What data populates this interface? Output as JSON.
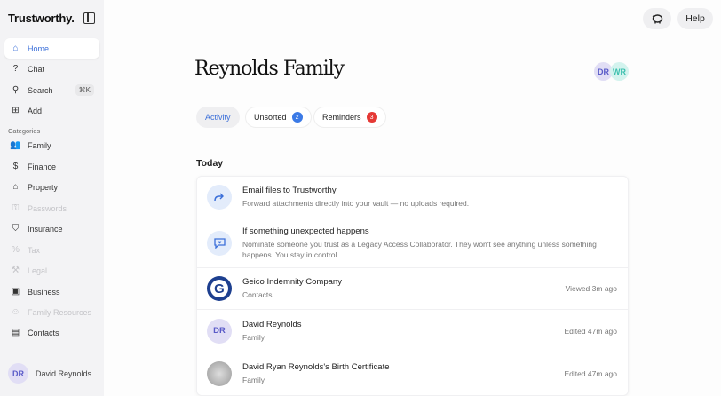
{
  "sidebar": {
    "brand": "Trustworthy.",
    "search_shortcut": "⌘K",
    "categories_label": "Categories",
    "items": [
      {
        "label": "Home",
        "icon": "home-icon",
        "glyph": "⌂",
        "state": "active"
      },
      {
        "label": "Chat",
        "icon": "chat-icon",
        "glyph": "?",
        "state": "normal"
      },
      {
        "label": "Search",
        "icon": "search-icon",
        "glyph": "⚲",
        "state": "normal"
      },
      {
        "label": "Add",
        "icon": "add-icon",
        "glyph": "⊞",
        "state": "normal"
      },
      {
        "label": "Family",
        "icon": "family-icon",
        "glyph": "👥",
        "state": "normal"
      },
      {
        "label": "Finance",
        "icon": "dollar-icon",
        "glyph": "$",
        "state": "normal"
      },
      {
        "label": "Property",
        "icon": "property-icon",
        "glyph": "⌂",
        "state": "normal"
      },
      {
        "label": "Passwords",
        "icon": "key-icon",
        "glyph": "⚿",
        "state": "disabled"
      },
      {
        "label": "Insurance",
        "icon": "shield-icon",
        "glyph": "⛉",
        "state": "normal"
      },
      {
        "label": "Tax",
        "icon": "percent-icon",
        "glyph": "%",
        "state": "disabled"
      },
      {
        "label": "Legal",
        "icon": "gavel-icon",
        "glyph": "⚒",
        "state": "disabled"
      },
      {
        "label": "Business",
        "icon": "briefcase-icon",
        "glyph": "▣",
        "state": "normal"
      },
      {
        "label": "Family Resources",
        "icon": "person-icon",
        "glyph": "☺",
        "state": "disabled"
      },
      {
        "label": "Contacts",
        "icon": "contacts-icon",
        "glyph": "▤",
        "state": "normal"
      }
    ],
    "user": {
      "initials": "DR",
      "name": "David Reynolds"
    }
  },
  "header": {
    "help_label": "Help",
    "piggy_icon": "piggy-bank-icon"
  },
  "main": {
    "title": "Reynolds Family",
    "members": [
      {
        "initials": "DR",
        "bg": "#e1def5",
        "fg": "#5a5bc8"
      },
      {
        "initials": "WR",
        "bg": "#d3f3ee",
        "fg": "#3cbfae"
      }
    ],
    "tabs": [
      {
        "label": "Activity",
        "active": true
      },
      {
        "label": "Unsorted",
        "count": "2",
        "badge_color": "#3b7ae6"
      },
      {
        "label": "Reminders",
        "count": "3",
        "badge_color": "#e53935"
      }
    ],
    "section": "Today",
    "rows": [
      {
        "title": "Email files to Trustworthy",
        "subtitle": "Forward attachments directly into your vault — no uploads required.",
        "icon": "forward-arrow-icon"
      },
      {
        "title": "If something unexpected happens",
        "subtitle": "Nominate someone you trust as a Legacy Access Collaborator. They won't see anything unless something happens. You stay in control.",
        "icon": "message-heart-icon"
      },
      {
        "title": "Geico Indemnity Company",
        "subtitle": "Contacts",
        "meta": "Viewed 3m ago",
        "icon": "geico-logo"
      },
      {
        "title": "David Reynolds",
        "subtitle": "Family",
        "meta": "Edited 47m ago",
        "initials": "DR"
      },
      {
        "title": "David Ryan Reynolds's Birth Certificate",
        "subtitle": "Family",
        "meta": "Edited 47m ago",
        "icon": "document-thumbnail"
      }
    ]
  }
}
